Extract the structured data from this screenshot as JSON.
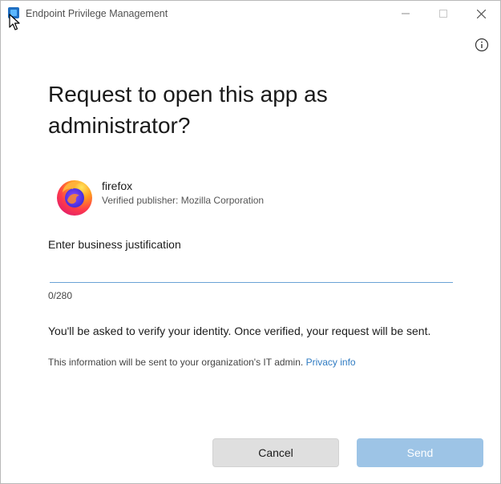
{
  "window": {
    "title": "Endpoint Privilege Management"
  },
  "dialog": {
    "heading": "Request to open this app as administrator?",
    "app": {
      "name": "firefox",
      "publisher": "Verified publisher: Mozilla Corporation",
      "icon": "firefox-icon"
    },
    "justification": {
      "label": "Enter business justification",
      "value": "",
      "char_count": "0/280"
    },
    "verify_text": "You'll be asked to verify your identity. Once verified, your request will be sent.",
    "notice_text": "This information will be sent to your organization's IT admin.",
    "privacy_link": "Privacy info"
  },
  "buttons": {
    "cancel": "Cancel",
    "send": "Send"
  },
  "colors": {
    "accent": "#2f7bc2",
    "send_disabled": "#9dc4e6",
    "input_underline": "#6aa3d6"
  }
}
